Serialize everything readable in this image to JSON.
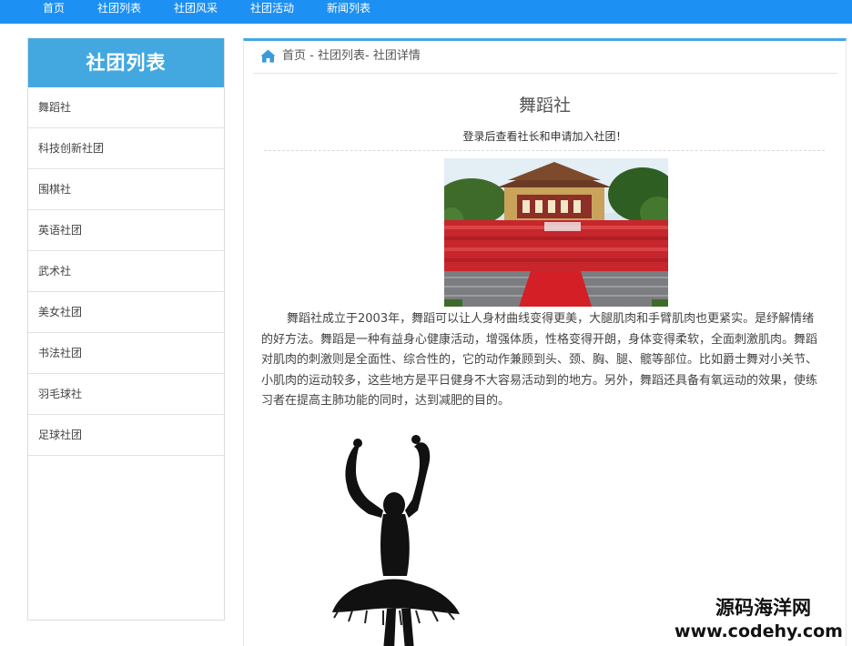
{
  "nav": {
    "items": [
      {
        "label": "首页"
      },
      {
        "label": "社团列表"
      },
      {
        "label": "社团风采"
      },
      {
        "label": "社团活动"
      },
      {
        "label": "新闻列表"
      }
    ]
  },
  "sidebar": {
    "title": "社团列表",
    "items": [
      {
        "label": "舞蹈社"
      },
      {
        "label": "科技创新社团"
      },
      {
        "label": "围棋社"
      },
      {
        "label": "英语社团"
      },
      {
        "label": "武术社"
      },
      {
        "label": "美女社团"
      },
      {
        "label": "书法社团"
      },
      {
        "label": "羽毛球社"
      },
      {
        "label": "足球社团"
      }
    ]
  },
  "breadcrumb": {
    "home": "首页",
    "sep1": " - ",
    "list": "社团列表",
    "sep2": "- ",
    "detail": "社团详情"
  },
  "club": {
    "name": "舞蹈社",
    "login_notice": "登录后查看社长和申请加入社团！",
    "description": "舞蹈社成立于2003年，舞蹈可以让人身材曲线变得更美，大腿肌肉和手臂肌肉也更紧实。是纾解情绪的好方法。舞蹈是一种有益身心健康活动，增强体质，性格变得开朗，身体变得柔软，全面刺激肌肉。舞蹈对肌肉的刺激则是全面性、综合性的，它的动作兼顾到头、颈、胸、腿、髋等部位。比如爵士舞对小关节、小肌肉的运动较多，这些地方是平日健身不大容易活动到的地方。另外，舞蹈还具备有氧运动的效果，使练习者在提高主肺功能的同时，达到减肥的目的。"
  },
  "watermark": {
    "line1": "源码海洋网",
    "line2": "www.codehy.com"
  },
  "colors": {
    "nav_bg": "#1c90f3",
    "accent": "#43a8e0"
  }
}
